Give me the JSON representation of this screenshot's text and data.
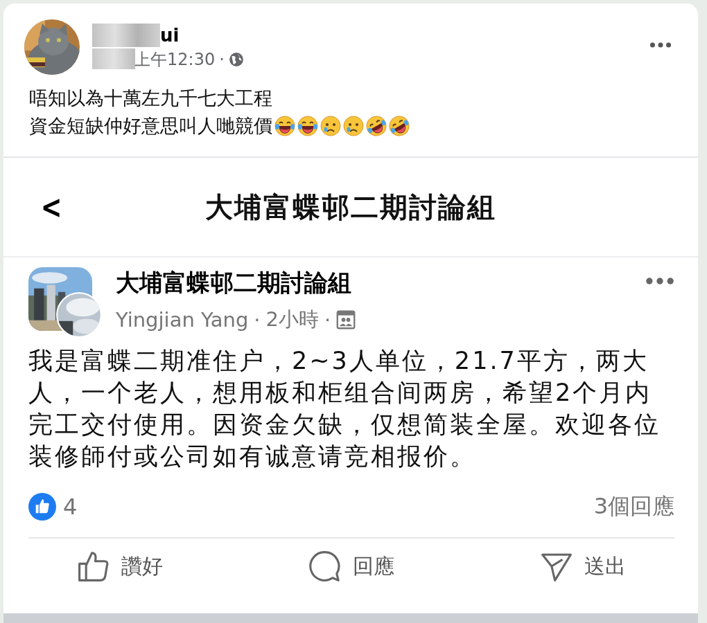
{
  "post": {
    "author": "ui",
    "time": "上午12:30",
    "sep": "·",
    "lines": [
      "唔知以為十萬左九千七大工程",
      "資金短缺仲好意思叫人哋競價"
    ],
    "emojis": [
      {
        "kind": "laugh"
      },
      {
        "kind": "laugh"
      },
      {
        "kind": "sad"
      },
      {
        "kind": "sad"
      },
      {
        "kind": "rofl"
      },
      {
        "kind": "rofl"
      }
    ]
  },
  "shared": {
    "back": "<",
    "title": "大埔富蝶邨二期討論組",
    "group": "大埔富蝶邨二期討論組",
    "author": "Yingjian Yang",
    "time": "2小時",
    "seps": [
      "·",
      "·"
    ],
    "body": "我是富蝶二期准住户，2~3人单位，21.7平方，两大人，一个老人，想用板和柜组合间两房，希望2个月内完工交付使用。因资金欠缺，仅想简装全屋。欢迎各位装修師付或公司如有诚意请竞相报价。",
    "likes": "4",
    "comments": "3個回應",
    "actions": [
      {
        "kind": "like",
        "label": "讚好"
      },
      {
        "kind": "comment",
        "label": "回應"
      },
      {
        "kind": "send",
        "label": "送出"
      }
    ]
  }
}
